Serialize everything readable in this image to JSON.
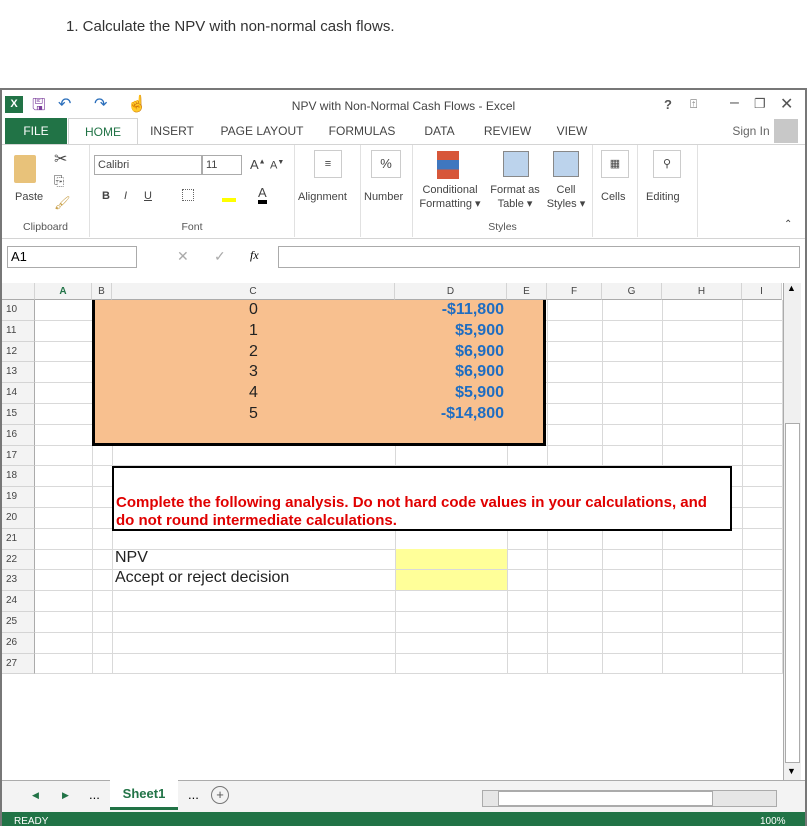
{
  "question": "1. Calculate the NPV with non-normal cash flows.",
  "window": {
    "title": "NPV with Non-Normal Cash Flows - Excel",
    "help": "?",
    "sign_in": "Sign In"
  },
  "tabs": [
    "FILE",
    "HOME",
    "INSERT",
    "PAGE LAYOUT",
    "FORMULAS",
    "DATA",
    "REVIEW",
    "VIEW"
  ],
  "ribbon": {
    "paste": "Paste",
    "clipboard": "Clipboard",
    "font_name": "Calibri",
    "font_size": "11",
    "font": "Font",
    "bold": "B",
    "italic": "I",
    "underline": "U",
    "alignment": "Alignment",
    "number": "Number",
    "percent": "%",
    "conditional": "Conditional",
    "formatting": "Formatting",
    "format_as": "Format as",
    "table": "Table",
    "cell": "Cell",
    "styles_btn": "Styles",
    "styles": "Styles",
    "cells": "Cells",
    "editing": "Editing"
  },
  "formula_bar": {
    "name_box": "A1",
    "fx": "fx",
    "value": ""
  },
  "columns": [
    "A",
    "B",
    "C",
    "D",
    "E",
    "F",
    "G",
    "H",
    "I"
  ],
  "rows": [
    "10",
    "11",
    "12",
    "13",
    "14",
    "15",
    "16",
    "17",
    "18",
    "19",
    "20",
    "21",
    "22",
    "23",
    "24",
    "25",
    "26",
    "27"
  ],
  "cash_flows": [
    {
      "year": "0",
      "cf": "-$11,800"
    },
    {
      "year": "1",
      "cf": "$5,900"
    },
    {
      "year": "2",
      "cf": "$6,900"
    },
    {
      "year": "3",
      "cf": "$6,900"
    },
    {
      "year": "4",
      "cf": "$5,900"
    },
    {
      "year": "5",
      "cf": "-$14,800"
    }
  ],
  "instruction": "Complete the following analysis. Do not hard code values in your calculations, and do not round intermediate calculations.",
  "labels": {
    "npv": "NPV",
    "decision": "Accept or reject decision"
  },
  "sheet": {
    "tab": "Sheet1",
    "more": "..."
  },
  "status": {
    "ready": "READY",
    "zoom": "100%"
  },
  "colors": {
    "excel_green": "#217346",
    "orange_fill": "#f8c08f",
    "yellow_fill": "#ffff99",
    "red_text": "#e00000",
    "blue_text": "#1f6dc1"
  }
}
